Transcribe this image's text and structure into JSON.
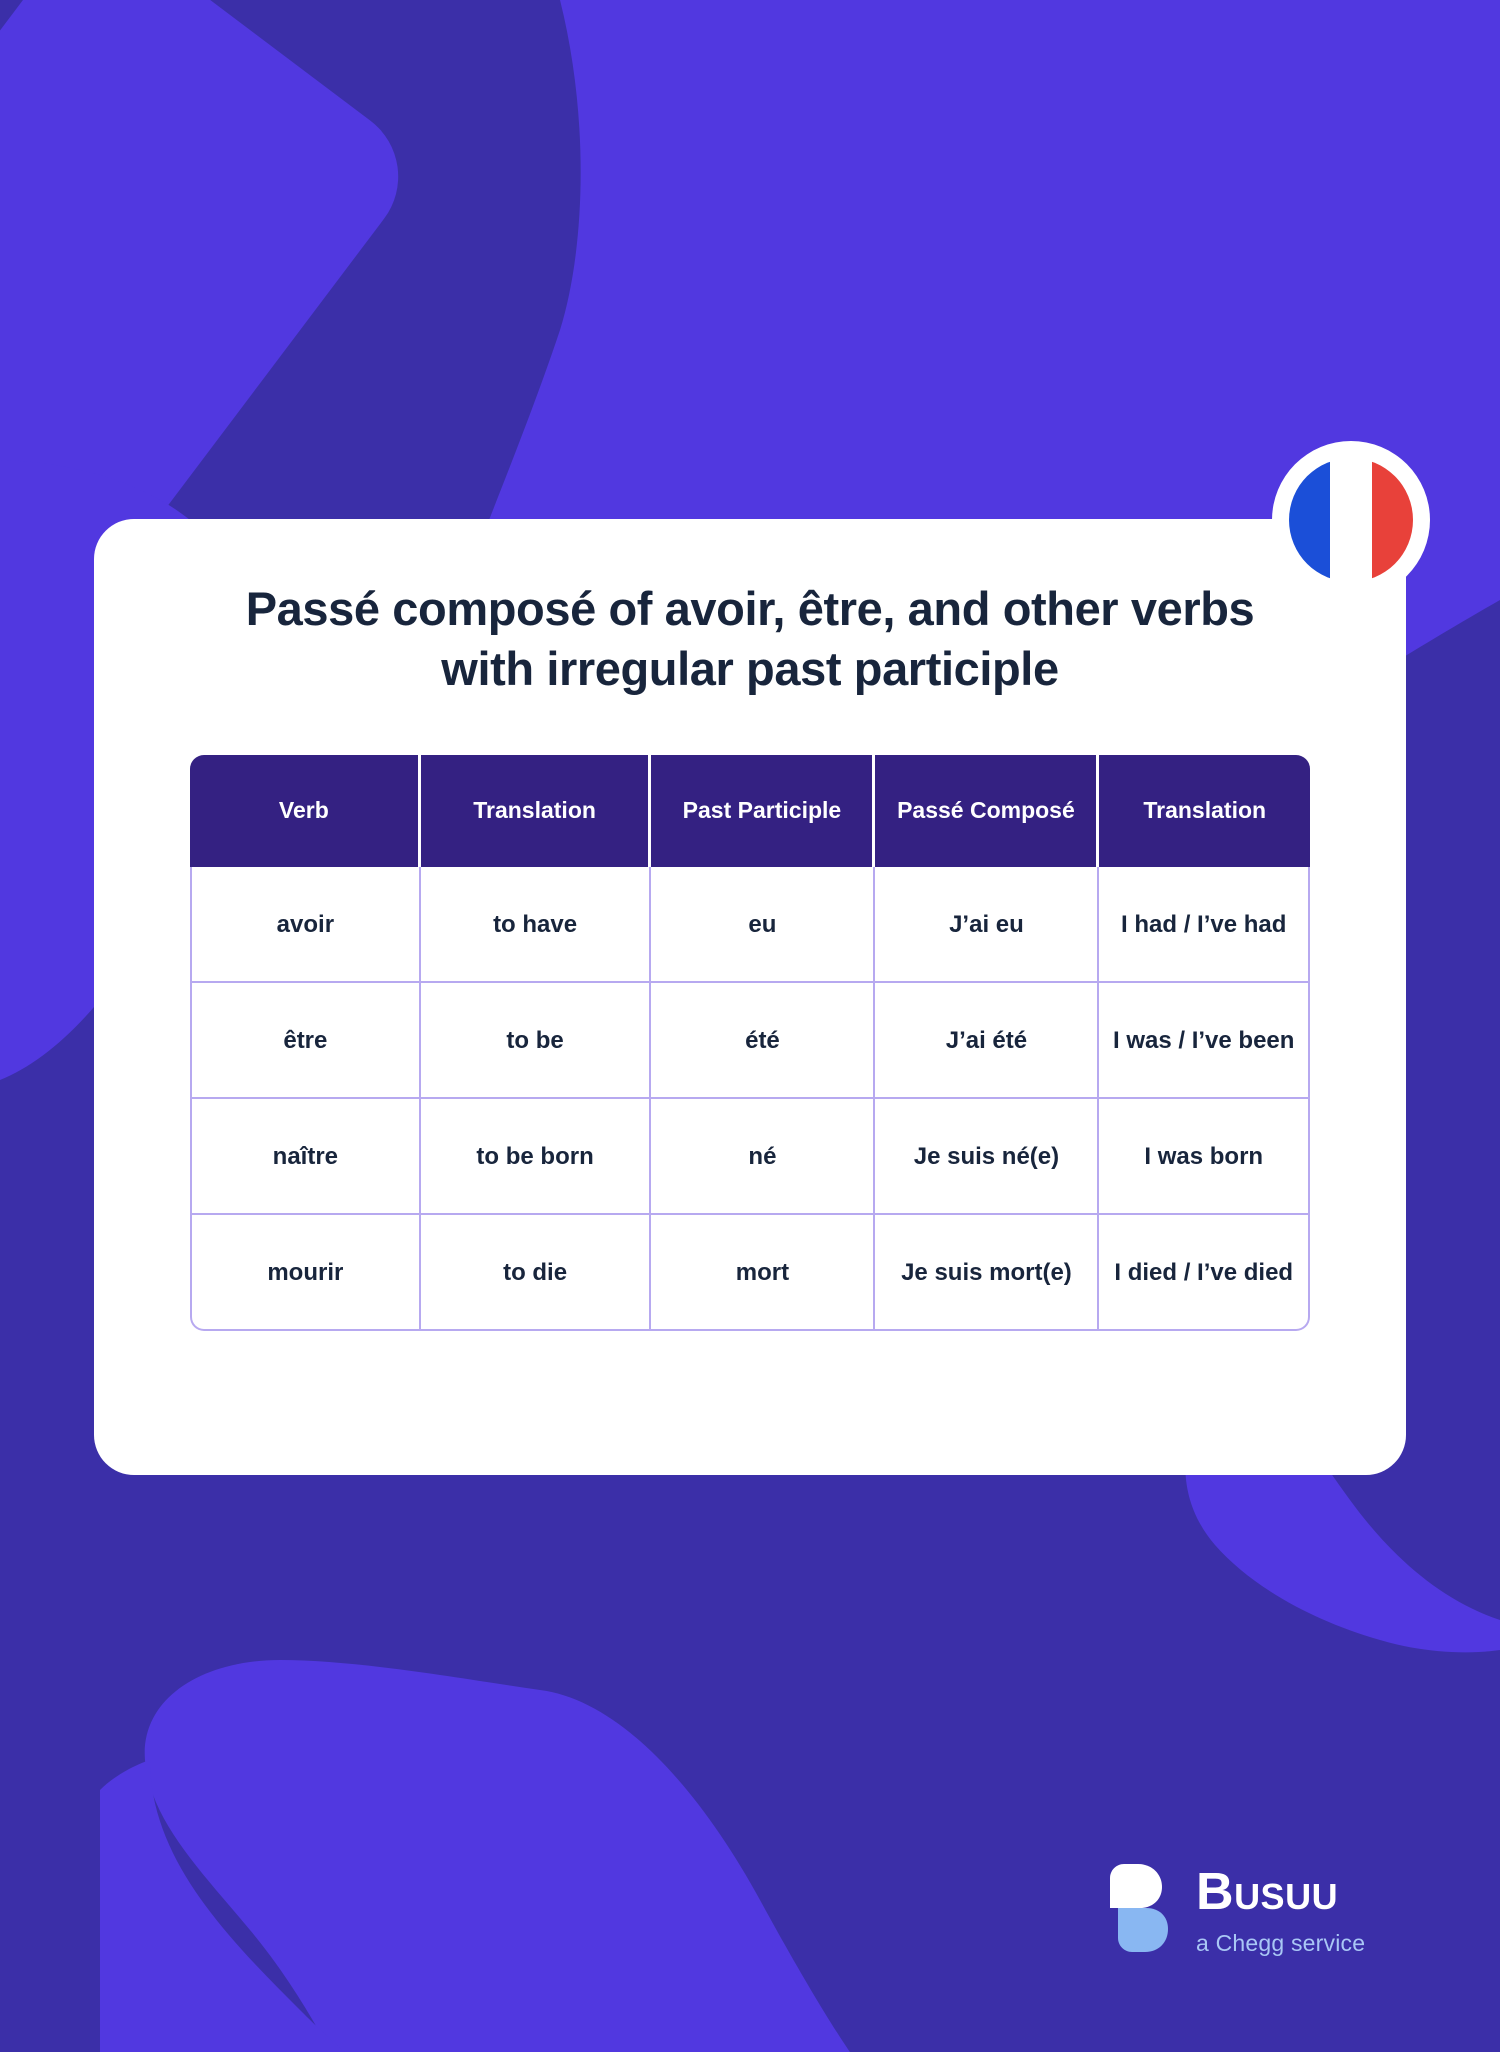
{
  "colors": {
    "background_dark": "#3B2FA8",
    "background_light": "#5138E0",
    "card_background": "#FFFFFF",
    "table_header_background": "#342182",
    "table_border": "#B7A9F0",
    "title_text": "#18253C",
    "logo_white": "#FFFFFF",
    "logo_light_blue": "#89B7F2",
    "tagline_text": "#A9C7F5",
    "flag_blue": "#1B4FD8",
    "flag_white": "#FFFFFF",
    "flag_red": "#E8413A"
  },
  "flag_badge": {
    "name": "france-flag-icon",
    "stripes": [
      "#1B4FD8",
      "#FFFFFF",
      "#E8413A"
    ]
  },
  "card": {
    "title": "Passé composé of avoir, être, and other verbs with irregular past participle"
  },
  "table": {
    "headers": [
      "Verb",
      "Translation",
      "Past Participle",
      "Passé Composé",
      "Translation"
    ],
    "rows": [
      {
        "verb": "avoir",
        "translation": "to have",
        "past_participle": "eu",
        "passe_compose": "J’ai eu",
        "translation_2": "I had / I’ve had"
      },
      {
        "verb": "être",
        "translation": "to be",
        "past_participle": "été",
        "passe_compose": "J’ai été",
        "translation_2": "I was / I’ve been"
      },
      {
        "verb": "naître",
        "translation": "to be born",
        "past_participle": "né",
        "passe_compose": "Je suis né(e)",
        "translation_2": "I was born"
      },
      {
        "verb": "mourir",
        "translation": "to die",
        "past_participle": "mort",
        "passe_compose": "Je suis mort(e)",
        "translation_2": "I died / I’ve died"
      }
    ]
  },
  "logo": {
    "wordmark": "Busuu",
    "tagline": "a Chegg service",
    "mark_name": "busuu-speech-bubble-icon"
  }
}
